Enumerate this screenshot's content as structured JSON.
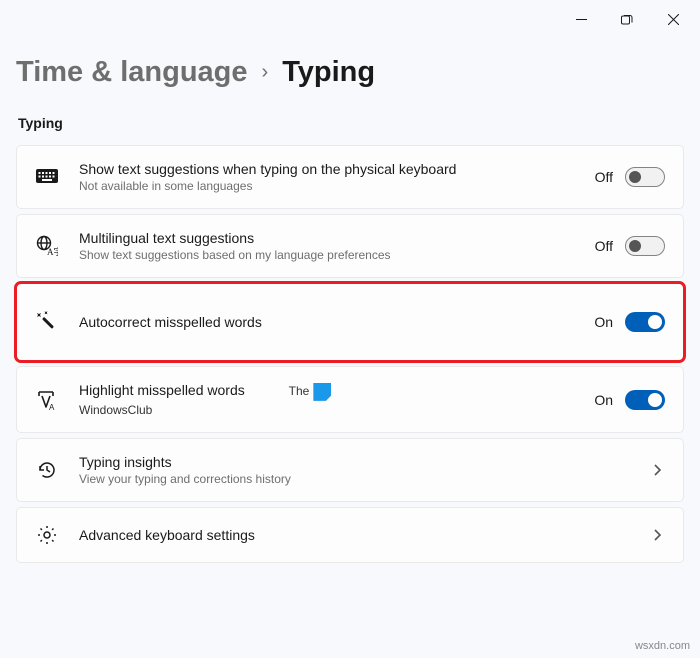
{
  "window": {
    "minimize_glyph": "—",
    "maximize_glyph": "❐",
    "close_glyph": "✕"
  },
  "breadcrumb": {
    "parent": "Time & language",
    "separator": "›",
    "current": "Typing"
  },
  "section_label": "Typing",
  "items": {
    "suggestions": {
      "title": "Show text suggestions when typing on the physical keyboard",
      "subtitle": "Not available in some languages",
      "state_label": "Off"
    },
    "multilingual": {
      "title": "Multilingual text suggestions",
      "subtitle": "Show text suggestions based on my language preferences",
      "state_label": "Off"
    },
    "autocorrect": {
      "title": "Autocorrect misspelled words",
      "state_label": "On"
    },
    "highlight": {
      "title": "Highlight misspelled words",
      "state_label": "On"
    },
    "insights": {
      "title": "Typing insights",
      "subtitle": "View your typing and corrections history"
    },
    "advanced": {
      "title": "Advanced keyboard settings"
    }
  },
  "watermark": {
    "line1": "The",
    "line2": "WindowsClub"
  },
  "credit": "wsxdn.com"
}
